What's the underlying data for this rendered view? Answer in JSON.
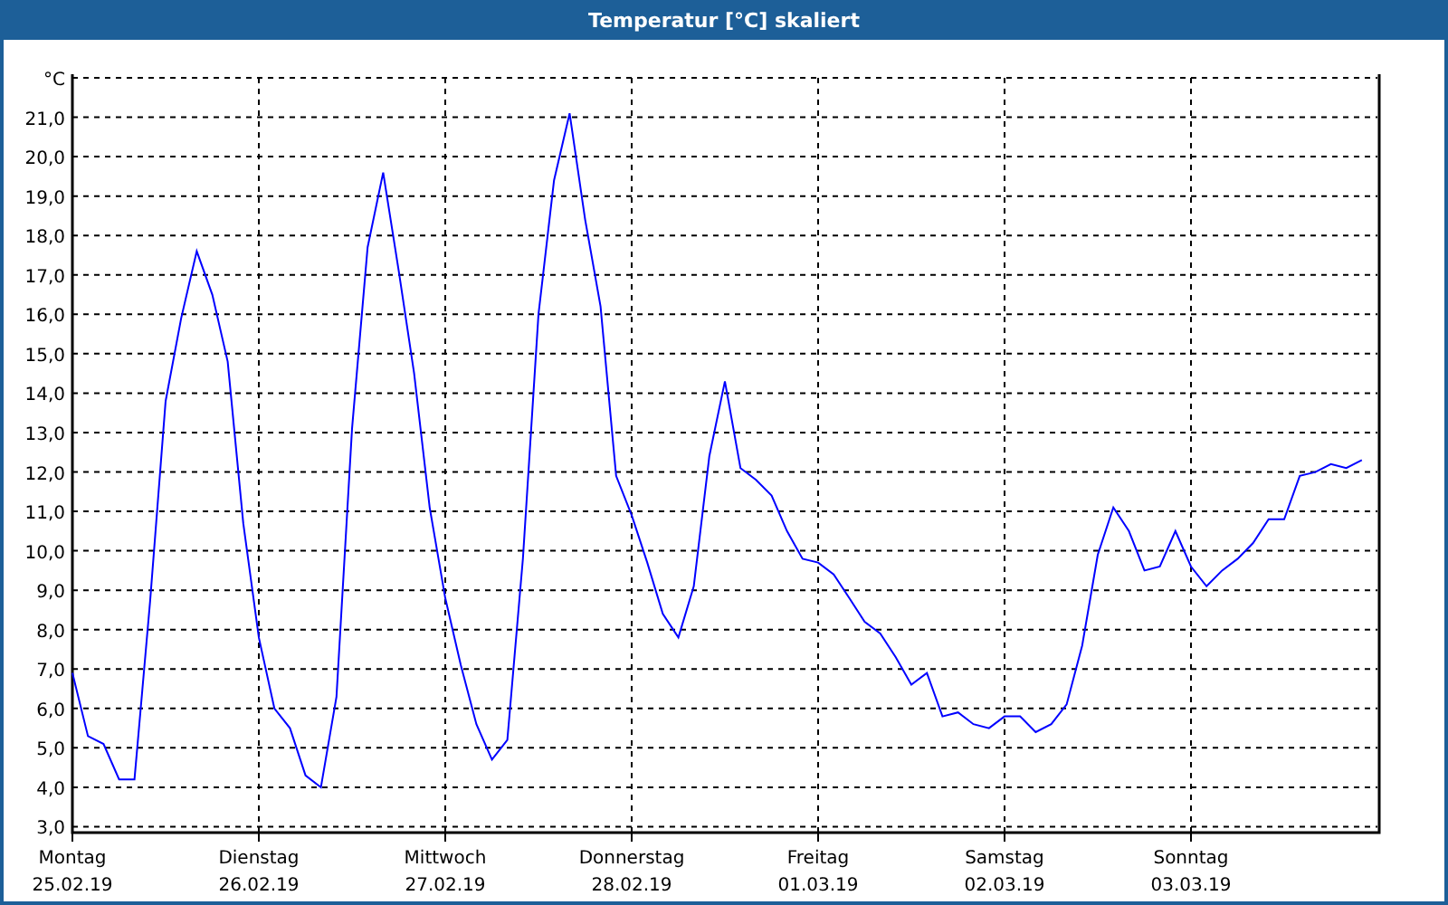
{
  "window": {
    "title": "Temperatur [°C] skaliert"
  },
  "chart": {
    "chart_data": {
      "type": "line",
      "grid": true,
      "ylabel": "°C",
      "ylim": [
        2.85,
        22
      ],
      "categories": [
        "Montag",
        null,
        null,
        null,
        null,
        null,
        null,
        null,
        null,
        null,
        null,
        null,
        "Dienstag",
        null,
        null,
        null,
        null,
        null,
        null,
        null,
        null,
        null,
        null,
        null,
        "Mittwoch",
        null,
        null,
        null,
        null,
        null,
        null,
        null,
        null,
        null,
        null,
        null,
        "Donnerstag",
        null,
        null,
        null,
        null,
        null,
        null,
        null,
        null,
        null,
        null,
        null,
        "Freitag",
        null,
        null,
        null,
        null,
        null,
        null,
        null,
        null,
        null,
        null,
        null,
        "Samstag",
        null,
        null,
        null,
        null,
        null,
        null,
        null,
        null,
        null,
        null,
        null,
        "Sonntag",
        null,
        null,
        null,
        null,
        null,
        null,
        null,
        null,
        null,
        null,
        null
      ],
      "yticks": [
        {
          "value": 3,
          "label": "3,0"
        },
        {
          "value": 4,
          "label": "4,0"
        },
        {
          "value": 5,
          "label": "5,0"
        },
        {
          "value": 6,
          "label": "6,0"
        },
        {
          "value": 7,
          "label": "7,0"
        },
        {
          "value": 8,
          "label": "8,0"
        },
        {
          "value": 9,
          "label": "9,0"
        },
        {
          "value": 10,
          "label": "10,0"
        },
        {
          "value": 11,
          "label": "11,0"
        },
        {
          "value": 12,
          "label": "12,0"
        },
        {
          "value": 13,
          "label": "13,0"
        },
        {
          "value": 14,
          "label": "14,0"
        },
        {
          "value": 15,
          "label": "15,0"
        },
        {
          "value": 16,
          "label": "16,0"
        },
        {
          "value": 17,
          "label": "17,0"
        },
        {
          "value": 18,
          "label": "18,0"
        },
        {
          "value": 19,
          "label": "19,0"
        },
        {
          "value": 20,
          "label": "20,0"
        },
        {
          "value": 21,
          "label": "21,0"
        }
      ],
      "series": [
        {
          "color": "#0000ff",
          "values": [
            6.9,
            5.3,
            5.1,
            4.2,
            4.2,
            8.7,
            13.8,
            15.9,
            17.6,
            16.5,
            14.8,
            10.7,
            7.8,
            6.0,
            5.5,
            4.3,
            4.0,
            6.3,
            13.1,
            17.7,
            19.6,
            17.1,
            14.5,
            11.1,
            8.8,
            7.1,
            5.6,
            4.7,
            5.2,
            9.8,
            16.0,
            19.4,
            21.1,
            18.4,
            16.2,
            11.9,
            10.9,
            9.7,
            8.4,
            7.8,
            9.1,
            12.4,
            14.3,
            12.1,
            11.8,
            11.4,
            10.5,
            9.8,
            9.7,
            9.4,
            8.8,
            8.2,
            7.9,
            7.3,
            6.6,
            6.9,
            5.8,
            5.9,
            5.6,
            5.5,
            5.8,
            5.8,
            5.4,
            5.6,
            6.1,
            7.6,
            9.9,
            11.1,
            10.5,
            9.5,
            9.6,
            10.5,
            9.6,
            9.1,
            9.5,
            9.8,
            10.2,
            10.8,
            10.8,
            11.9,
            12.0,
            12.2,
            12.1,
            12.3
          ]
        }
      ]
    },
    "x_axis_dates": [
      "25.02.19",
      "26.02.19",
      "27.02.19",
      "28.02.19",
      "01.03.19",
      "02.03.19",
      "03.03.19"
    ]
  }
}
